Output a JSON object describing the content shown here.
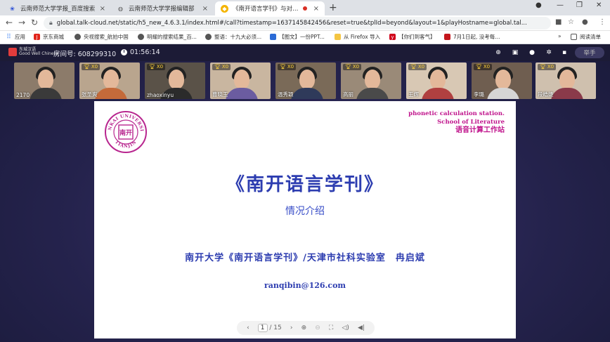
{
  "browser": {
    "tabs": [
      {
        "label": "云南师范大学学报_百度搜索",
        "active": false,
        "icon": "paw-icon"
      },
      {
        "label": "云南师范大学学报编辑部",
        "active": false,
        "icon": "globe-icon"
      },
      {
        "label": "《南开语言学刊》与对外汉语",
        "active": true,
        "icon": "app-icon"
      }
    ],
    "url": "global.talk-cloud.net/static/h5_new_4.6.3.1/index.html#/call?timestamp=1637145842456&reset=true&tplId=beyond&layout=1&playHostname=global.tal...",
    "bookmarks": [
      "应用",
      "京东商城",
      "央视搜索_航拍中国",
      "明耀的搜索结果_百...",
      "整语：十九大必须...",
      "【图文】一份PPT...",
      "从 Firefox 导入",
      "【你们到客气】",
      "7月1日起, 没考每..."
    ],
    "reading_list": "阅读清单"
  },
  "app": {
    "room_label": "房间号: 608299310",
    "timer": "01:56:14",
    "raise_hand": "举手",
    "logo_text": "东城汉语\nGood Well Chinese"
  },
  "participants": [
    {
      "name": "2170",
      "badge": "",
      "bg": "#8c7b6a",
      "body": "#3a3a3a"
    },
    {
      "name": "张圣爽",
      "badge": "X0",
      "bg": "#b9a58e",
      "body": "#c46a3a"
    },
    {
      "name": "zhaoxinyu",
      "badge": "X0",
      "bg": "#5a5248",
      "body": "#2b2b2b"
    },
    {
      "name": "曹晓玉",
      "badge": "X0",
      "bg": "#c9b6a0",
      "body": "#6b5ca0"
    },
    {
      "name": "温秀颖",
      "badge": "X0",
      "bg": "#7a6a58",
      "body": "#2f3a5a"
    },
    {
      "name": "高丽",
      "badge": "X0",
      "bg": "#9a8a78",
      "body": "#4a4a4a"
    },
    {
      "name": "王辉",
      "badge": "X0",
      "bg": "#d8c8b4",
      "body": "#b04040"
    },
    {
      "name": "李璐",
      "badge": "X0",
      "bg": "#6f5e50",
      "body": "#d5d5d5"
    },
    {
      "name": "段皓婕",
      "badge": "X0",
      "bg": "#cfc0ae",
      "body": "#8a3a4a"
    }
  ],
  "slide": {
    "seal_top": "NANKAI UNIVERSITY",
    "seal_bottom": "TIANJIN",
    "seal_center": "南开",
    "slogan_line1": "phonetic calculation station.",
    "slogan_line2": "School of Literature",
    "slogan_line3": "语音计算工作站",
    "title": "《南开语言学刊》",
    "subtitle": "情况介绍",
    "author": "南开大学《南开语言学刊》/天津市社科实验室　冉启斌",
    "email": "ranqibin@126.com"
  },
  "pager": {
    "current": "1",
    "total": "/ 15"
  },
  "colors": {
    "slide_blue": "#2d3db0",
    "slogan_magenta": "#c0148c",
    "seal_magenta": "#b8268f",
    "app_bg": "#25234d"
  }
}
